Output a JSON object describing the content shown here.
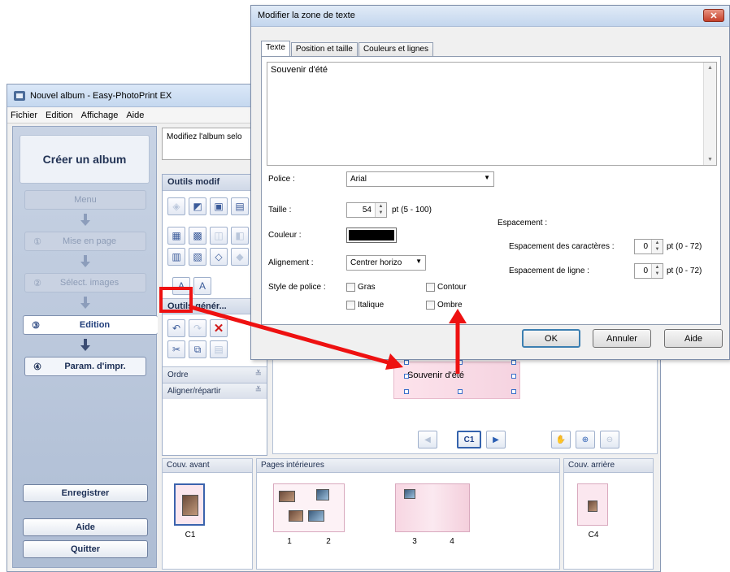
{
  "main_window": {
    "title": "Nouvel album - Easy-PhotoPrint EX",
    "menu": [
      "Fichier",
      "Edition",
      "Affichage",
      "Aide"
    ]
  },
  "sidebar": {
    "header": "Créer un album",
    "steps": [
      {
        "num": "",
        "label": "Menu",
        "state": "disabled"
      },
      {
        "num": "①",
        "label": "Mise en page",
        "state": "disabled"
      },
      {
        "num": "②",
        "label": "Sélect. images",
        "state": "disabled"
      },
      {
        "num": "③",
        "label": "Edition",
        "state": "active"
      },
      {
        "num": "④",
        "label": "Param. d'impr.",
        "state": "normal"
      }
    ],
    "save_label": "Enregistrer",
    "help_label": "Aide",
    "quit_label": "Quitter"
  },
  "instructions": "Modifiez l'album selo",
  "tools": {
    "edit_header": "Outils modif",
    "general_header": "Outils génér...",
    "order_label": "Ordre",
    "align_label": "Aligner/répartir"
  },
  "preview": {
    "text": "Souvenir d'été",
    "page_selector": "C1"
  },
  "thumbnails": {
    "front_header": "Couv. avant",
    "inner_header": "Pages intérieures",
    "back_header": "Couv. arrière",
    "labels": [
      "C1",
      "1",
      "2",
      "3",
      "4",
      "C4"
    ]
  },
  "dialog": {
    "title": "Modifier la zone de texte",
    "tabs": [
      "Texte",
      "Position et taille",
      "Couleurs et lignes"
    ],
    "text_value": "Souvenir d'été",
    "font_label": "Police :",
    "font_value": "Arial",
    "size_label": "Taille :",
    "size_value": "54",
    "size_range": "pt (5 - 100)",
    "color_label": "Couleur :",
    "align_label": "Alignement :",
    "align_value": "Centrer horizo",
    "style_label": "Style de police :",
    "bold": "Gras",
    "italic": "Italique",
    "outline": "Contour",
    "shadow": "Ombre",
    "spacing_header": "Espacement :",
    "char_spacing_label": "Espacement des caractères :",
    "char_spacing_value": "0",
    "char_spacing_range": "pt (0 - 72)",
    "line_spacing_label": "Espacement de ligne :",
    "line_spacing_value": "0",
    "line_spacing_range": "pt (0 - 72)",
    "ok": "OK",
    "cancel": "Annuler",
    "help": "Aide"
  },
  "colors": {
    "annotation": "#ee1111",
    "font_color": "#000000"
  }
}
